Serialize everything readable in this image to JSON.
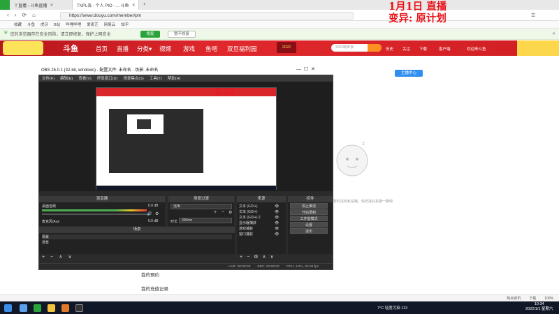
{
  "overlay": {
    "line1": "1月1日 直播",
    "line2": "变异: 原计划"
  },
  "browser": {
    "tabs": [
      {
        "label": "丫直播 - 斗鱼直播",
        "active": false
      },
      {
        "label": "TNPL各 - 个人 PtO - ... 斗鱼",
        "active": true
      }
    ],
    "url": "https://www.douyu.com/member/pm",
    "bookmarks": [
      "收藏",
      "斗鱼",
      "虎牙",
      "B站",
      "哔哩哔哩",
      "爱奇艺",
      "网易云",
      "知乎"
    ],
    "notice_text": "您的浏览器存在安全风险，请立即修复，保护上网安全",
    "notice_btn_primary": "修复",
    "notice_btn_secondary": "暂不修复"
  },
  "douyu": {
    "nav": [
      "首页",
      "直播",
      "分类▾",
      "视频",
      "游戏",
      "鱼吧",
      "双旦福利园"
    ],
    "event_badge": "2022",
    "search_placeholder": "2022跨年夜",
    "header_right": [
      "历史",
      "关注",
      "下载",
      "客户端",
      "欢迎来斗鱼"
    ],
    "anchor_center_btn": "主播中心",
    "empty_text": "暂时没有私信哦，快去找好友聊一聊吧",
    "side_links": [
      "我的预约",
      "我的充值记录"
    ]
  },
  "obs": {
    "title": "OBS 25.0.1 (32-bit, windows) - 配置文件: 未命名 - 场景: 未命名",
    "menu": [
      "文件(F)",
      "编辑(E)",
      "查看(V)",
      "停靠窗口(D)",
      "场景集合(S)",
      "工具(T)",
      "帮助(H)"
    ],
    "mixer": {
      "title": "混音器",
      "tracks": [
        {
          "name": "桌面音频",
          "db": "0.0 dB"
        },
        {
          "name": "麦克风/Aux",
          "db": "0.0 dB"
        }
      ]
    },
    "transitions": {
      "title": "场景过渡",
      "type": "淡出",
      "duration_label": "时长",
      "duration_value": "300ms"
    },
    "sources": {
      "title": "来源",
      "items": [
        "文本 (GDI+)",
        "文本 (GDI+)",
        "文本 (GDI+) 2",
        "显示器捕获",
        "游戏捕获",
        "窗口捕获"
      ]
    },
    "controls": {
      "title": "控件",
      "buttons": [
        "停止推流",
        "开始录制",
        "工作室模式",
        "设置",
        "退出"
      ]
    },
    "scenes": {
      "title": "场景",
      "items": [
        "场景",
        "场景"
      ]
    },
    "status": {
      "live": "LIVE: 00:00:00",
      "rec": "REC: 00:00:00",
      "cpu": "CPU: 4.0%, 60.00 fps"
    }
  },
  "status_bar": {
    "items": [
      "热点资讯",
      "下载",
      "100%"
    ]
  },
  "taskbar": {
    "weather": "7°C 轻度污染 113",
    "time": "10:34",
    "date": "2022/1/1 星期六"
  }
}
